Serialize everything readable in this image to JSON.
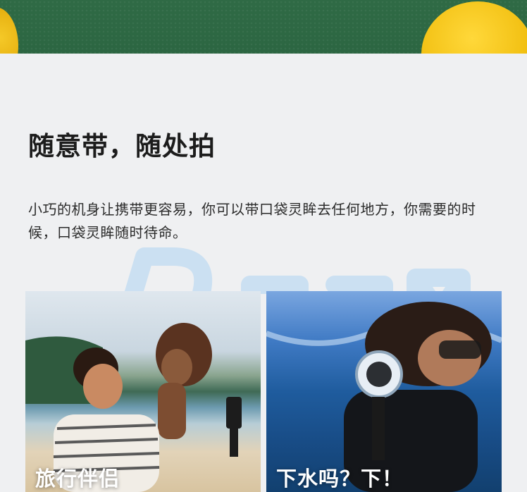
{
  "section": {
    "heading": "随意带，随处拍",
    "description": "小巧的机身让携带更容易，你可以带口袋灵眸去任何地方，你需要的时候，口袋灵眸随时待命。"
  },
  "cards": [
    {
      "caption": "旅行伴侣"
    },
    {
      "caption": "下水吗？下！"
    }
  ],
  "colors": {
    "hero_background": "#2f6a45",
    "lemon": "#f2c012",
    "page_background": "#eff0f2",
    "watermark": "#aed4f2"
  }
}
